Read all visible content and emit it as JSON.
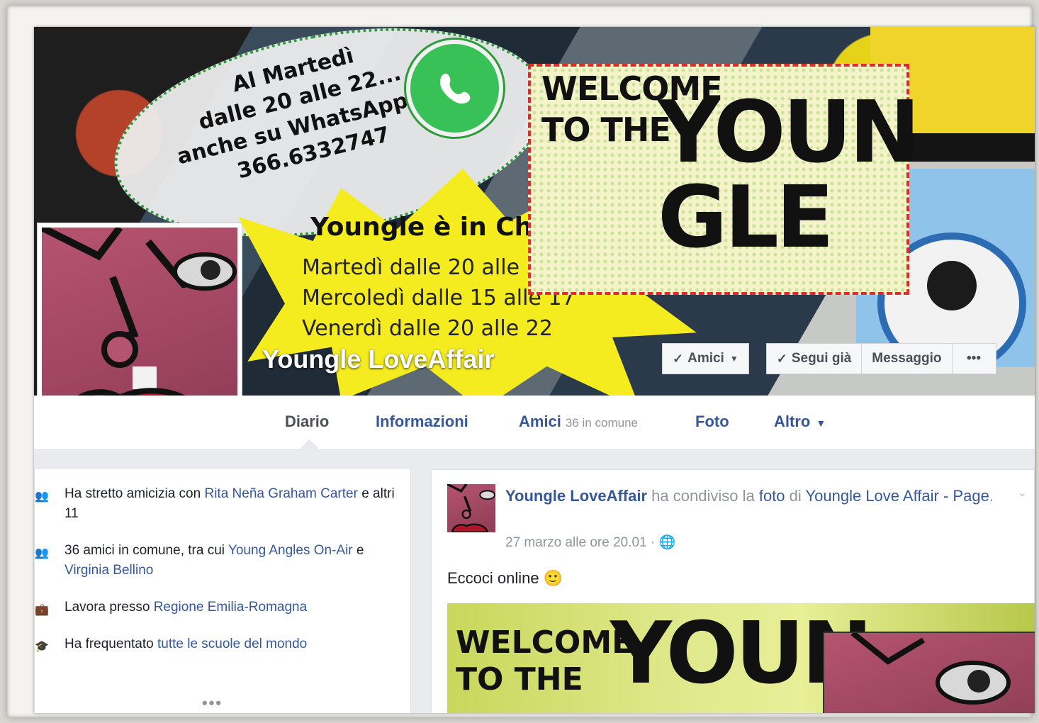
{
  "cover": {
    "bubble_lines": [
      "Al Martedì",
      "dalle 20 alle 22...",
      "anche su WhatsApp!!!",
      "366.6332747"
    ],
    "chat_title": "Youngle è in Chat:",
    "chat_lines": [
      "Martedì  dalle 20 alle 22",
      "Mercoledì dalle 15 alle 17",
      "Venerdì dalle 20 alle 22"
    ],
    "welcome_small": [
      "WELCOME",
      "TO THE"
    ],
    "welcome_big": [
      "YOUN",
      "GLE"
    ],
    "page_name": "Youngle LoveAffair",
    "buttons": {
      "friends": "Amici",
      "following": "Segui già",
      "message": "Messaggio",
      "more": "•••"
    }
  },
  "nav": {
    "tabs": [
      {
        "label": "Diario"
      },
      {
        "label": "Informazioni"
      },
      {
        "label": "Amici",
        "sub": "36 in comune"
      },
      {
        "label": "Foto"
      },
      {
        "label": "Altro"
      }
    ]
  },
  "intro": {
    "rows": [
      {
        "pre": "Ha stretto amicizia con ",
        "link": "Rita Neña Graham Carter",
        "post": " e altri 11"
      },
      {
        "pre": "36 amici in comune, tra cui ",
        "link": "Young Angles On-Air",
        "mid": " e ",
        "link2": "Virginia Bellino"
      },
      {
        "pre": "Lavora presso ",
        "link": "Regione Emilia-Romagna"
      },
      {
        "pre": "Ha frequentato ",
        "link": "tutte le scuole del mondo"
      }
    ],
    "more": "•••"
  },
  "post": {
    "author": "Youngle LoveAffair",
    "action": " ha condiviso la ",
    "object": "foto",
    "of": " di ",
    "source": "Youngle Love Affair - Page",
    "source_suffix": ".",
    "time": "27 marzo alle ore 20.01",
    "separator": "·",
    "body": "Eccoci online",
    "emoji": "🙂",
    "image_text_small": [
      "WELCOME",
      "TO THE"
    ],
    "image_text_big": "YOUN"
  },
  "colors": {
    "link": "#365899",
    "bg": "#e9ebee",
    "whatsapp": "#38c157",
    "star": "#f4ec1f",
    "dash": "#e22a2a"
  }
}
